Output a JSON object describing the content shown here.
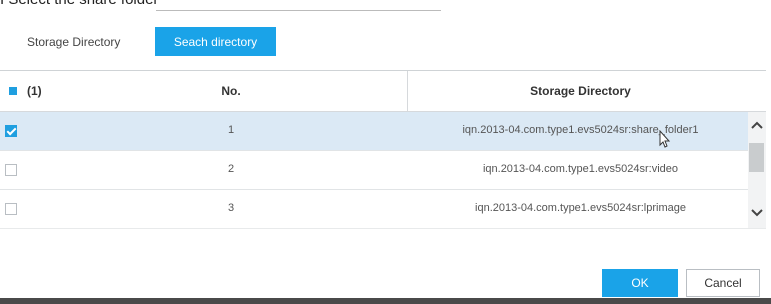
{
  "caption": "I Select the share folder",
  "storage": {
    "label": "Storage Directory",
    "search_button": "Seach directory"
  },
  "table": {
    "header": {
      "count": "(1)",
      "no": "No.",
      "directory": "Storage Directory"
    },
    "rows": [
      {
        "no": "1",
        "directory": "iqn.2013-04.com.type1.evs5024sr:share_folder1",
        "checked": true,
        "selected": true
      },
      {
        "no": "2",
        "directory": "iqn.2013-04.com.type1.evs5024sr:video",
        "checked": false,
        "selected": false
      },
      {
        "no": "3",
        "directory": "iqn.2013-04.com.type1.evs5024sr:lprimage",
        "checked": false,
        "selected": false
      }
    ]
  },
  "footer": {
    "ok": "OK",
    "cancel": "Cancel"
  },
  "colors": {
    "accent": "#1aa3e8",
    "selected_row": "#dbe9f5"
  },
  "icons": {
    "scroll_up": "chevron-up-icon",
    "scroll_down": "chevron-down-icon",
    "cursor": "mouse-pointer-icon"
  }
}
